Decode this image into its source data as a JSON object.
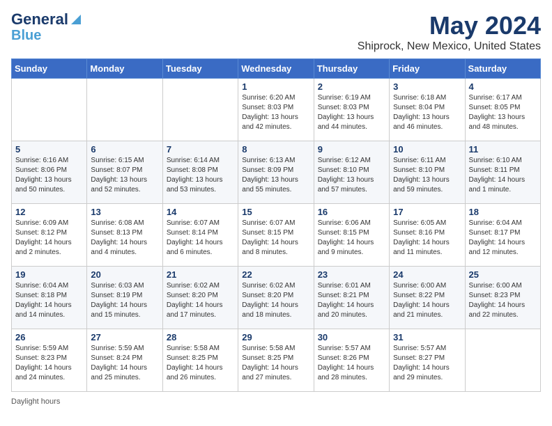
{
  "header": {
    "logo_line1": "General",
    "logo_line2": "Blue",
    "month": "May 2024",
    "location": "Shiprock, New Mexico, United States"
  },
  "days_of_week": [
    "Sunday",
    "Monday",
    "Tuesday",
    "Wednesday",
    "Thursday",
    "Friday",
    "Saturday"
  ],
  "weeks": [
    [
      {
        "day": "",
        "info": ""
      },
      {
        "day": "",
        "info": ""
      },
      {
        "day": "",
        "info": ""
      },
      {
        "day": "1",
        "info": "Sunrise: 6:20 AM\nSunset: 8:03 PM\nDaylight: 13 hours\nand 42 minutes."
      },
      {
        "day": "2",
        "info": "Sunrise: 6:19 AM\nSunset: 8:03 PM\nDaylight: 13 hours\nand 44 minutes."
      },
      {
        "day": "3",
        "info": "Sunrise: 6:18 AM\nSunset: 8:04 PM\nDaylight: 13 hours\nand 46 minutes."
      },
      {
        "day": "4",
        "info": "Sunrise: 6:17 AM\nSunset: 8:05 PM\nDaylight: 13 hours\nand 48 minutes."
      }
    ],
    [
      {
        "day": "5",
        "info": "Sunrise: 6:16 AM\nSunset: 8:06 PM\nDaylight: 13 hours\nand 50 minutes."
      },
      {
        "day": "6",
        "info": "Sunrise: 6:15 AM\nSunset: 8:07 PM\nDaylight: 13 hours\nand 52 minutes."
      },
      {
        "day": "7",
        "info": "Sunrise: 6:14 AM\nSunset: 8:08 PM\nDaylight: 13 hours\nand 53 minutes."
      },
      {
        "day": "8",
        "info": "Sunrise: 6:13 AM\nSunset: 8:09 PM\nDaylight: 13 hours\nand 55 minutes."
      },
      {
        "day": "9",
        "info": "Sunrise: 6:12 AM\nSunset: 8:10 PM\nDaylight: 13 hours\nand 57 minutes."
      },
      {
        "day": "10",
        "info": "Sunrise: 6:11 AM\nSunset: 8:10 PM\nDaylight: 13 hours\nand 59 minutes."
      },
      {
        "day": "11",
        "info": "Sunrise: 6:10 AM\nSunset: 8:11 PM\nDaylight: 14 hours\nand 1 minute."
      }
    ],
    [
      {
        "day": "12",
        "info": "Sunrise: 6:09 AM\nSunset: 8:12 PM\nDaylight: 14 hours\nand 2 minutes."
      },
      {
        "day": "13",
        "info": "Sunrise: 6:08 AM\nSunset: 8:13 PM\nDaylight: 14 hours\nand 4 minutes."
      },
      {
        "day": "14",
        "info": "Sunrise: 6:07 AM\nSunset: 8:14 PM\nDaylight: 14 hours\nand 6 minutes."
      },
      {
        "day": "15",
        "info": "Sunrise: 6:07 AM\nSunset: 8:15 PM\nDaylight: 14 hours\nand 8 minutes."
      },
      {
        "day": "16",
        "info": "Sunrise: 6:06 AM\nSunset: 8:15 PM\nDaylight: 14 hours\nand 9 minutes."
      },
      {
        "day": "17",
        "info": "Sunrise: 6:05 AM\nSunset: 8:16 PM\nDaylight: 14 hours\nand 11 minutes."
      },
      {
        "day": "18",
        "info": "Sunrise: 6:04 AM\nSunset: 8:17 PM\nDaylight: 14 hours\nand 12 minutes."
      }
    ],
    [
      {
        "day": "19",
        "info": "Sunrise: 6:04 AM\nSunset: 8:18 PM\nDaylight: 14 hours\nand 14 minutes."
      },
      {
        "day": "20",
        "info": "Sunrise: 6:03 AM\nSunset: 8:19 PM\nDaylight: 14 hours\nand 15 minutes."
      },
      {
        "day": "21",
        "info": "Sunrise: 6:02 AM\nSunset: 8:20 PM\nDaylight: 14 hours\nand 17 minutes."
      },
      {
        "day": "22",
        "info": "Sunrise: 6:02 AM\nSunset: 8:20 PM\nDaylight: 14 hours\nand 18 minutes."
      },
      {
        "day": "23",
        "info": "Sunrise: 6:01 AM\nSunset: 8:21 PM\nDaylight: 14 hours\nand 20 minutes."
      },
      {
        "day": "24",
        "info": "Sunrise: 6:00 AM\nSunset: 8:22 PM\nDaylight: 14 hours\nand 21 minutes."
      },
      {
        "day": "25",
        "info": "Sunrise: 6:00 AM\nSunset: 8:23 PM\nDaylight: 14 hours\nand 22 minutes."
      }
    ],
    [
      {
        "day": "26",
        "info": "Sunrise: 5:59 AM\nSunset: 8:23 PM\nDaylight: 14 hours\nand 24 minutes."
      },
      {
        "day": "27",
        "info": "Sunrise: 5:59 AM\nSunset: 8:24 PM\nDaylight: 14 hours\nand 25 minutes."
      },
      {
        "day": "28",
        "info": "Sunrise: 5:58 AM\nSunset: 8:25 PM\nDaylight: 14 hours\nand 26 minutes."
      },
      {
        "day": "29",
        "info": "Sunrise: 5:58 AM\nSunset: 8:25 PM\nDaylight: 14 hours\nand 27 minutes."
      },
      {
        "day": "30",
        "info": "Sunrise: 5:57 AM\nSunset: 8:26 PM\nDaylight: 14 hours\nand 28 minutes."
      },
      {
        "day": "31",
        "info": "Sunrise: 5:57 AM\nSunset: 8:27 PM\nDaylight: 14 hours\nand 29 minutes."
      },
      {
        "day": "",
        "info": ""
      }
    ]
  ],
  "footer": {
    "daylight_hours_label": "Daylight hours"
  }
}
